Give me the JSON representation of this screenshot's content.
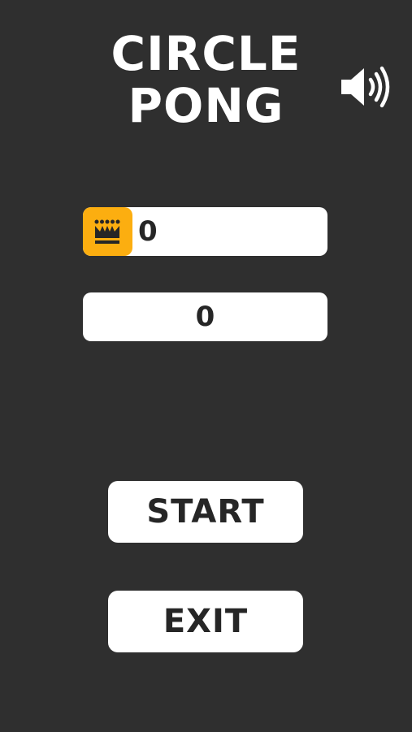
{
  "title": {
    "line1": "CIRCLE",
    "line2": "PONG"
  },
  "sound": {
    "icon": "speaker-volume-icon"
  },
  "best_score": {
    "icon": "crown-icon",
    "value": "0",
    "icon_color": "#fcae10"
  },
  "current_score": {
    "value": "0"
  },
  "menu": {
    "start_label": "START",
    "exit_label": "EXIT"
  },
  "colors": {
    "background": "#2f2f2f",
    "panel": "#ffffff",
    "text_dark": "#262626",
    "accent": "#fcae10"
  }
}
